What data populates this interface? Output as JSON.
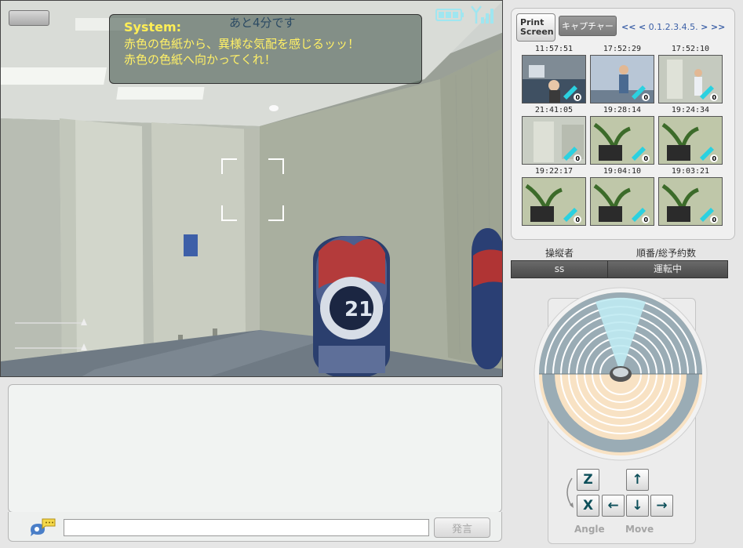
{
  "overlay": {
    "countdown": "あと4分です",
    "system_label": "System:",
    "system_lines": [
      "赤色の色紙から、異様な気配を感じるッッ！",
      "赤色の色紙へ向かってくれ！"
    ]
  },
  "camera": {
    "poster_text": "21"
  },
  "chat": {
    "input_value": "",
    "send_label": "発言"
  },
  "capture": {
    "print_label_line1": "Print",
    "print_label_line2": "Screen",
    "capture_label": "キャプチャー",
    "pager": {
      "first": "<<",
      "prev": "<",
      "pages": [
        "0",
        "1",
        "2",
        "3",
        "4",
        "5"
      ],
      "next": ">",
      "last": ">>"
    },
    "thumbnails": [
      {
        "time": "11:57:51"
      },
      {
        "time": "17:52:29"
      },
      {
        "time": "17:52:10"
      },
      {
        "time": "21:41:05"
      },
      {
        "time": "19:28:14"
      },
      {
        "time": "19:24:34"
      },
      {
        "time": "19:22:17"
      },
      {
        "time": "19:04:10"
      },
      {
        "time": "19:03:21"
      }
    ],
    "thumb_badge": "0"
  },
  "status": {
    "operator_header": "操縦者",
    "order_header": "順番/総予約数",
    "operator_value": "ss",
    "order_value": "運転中"
  },
  "controls": {
    "z_key": "Z",
    "x_key": "X",
    "up": "↑",
    "down": "↓",
    "left": "←",
    "right": "→",
    "angle_label": "Angle",
    "move_label": "Move"
  },
  "colors": {
    "accent_blue": "#3b5fa6",
    "overlay_text": "#fff066",
    "dial_sector": "#bfeaf2",
    "dial_peach": "#f8e2c4"
  }
}
